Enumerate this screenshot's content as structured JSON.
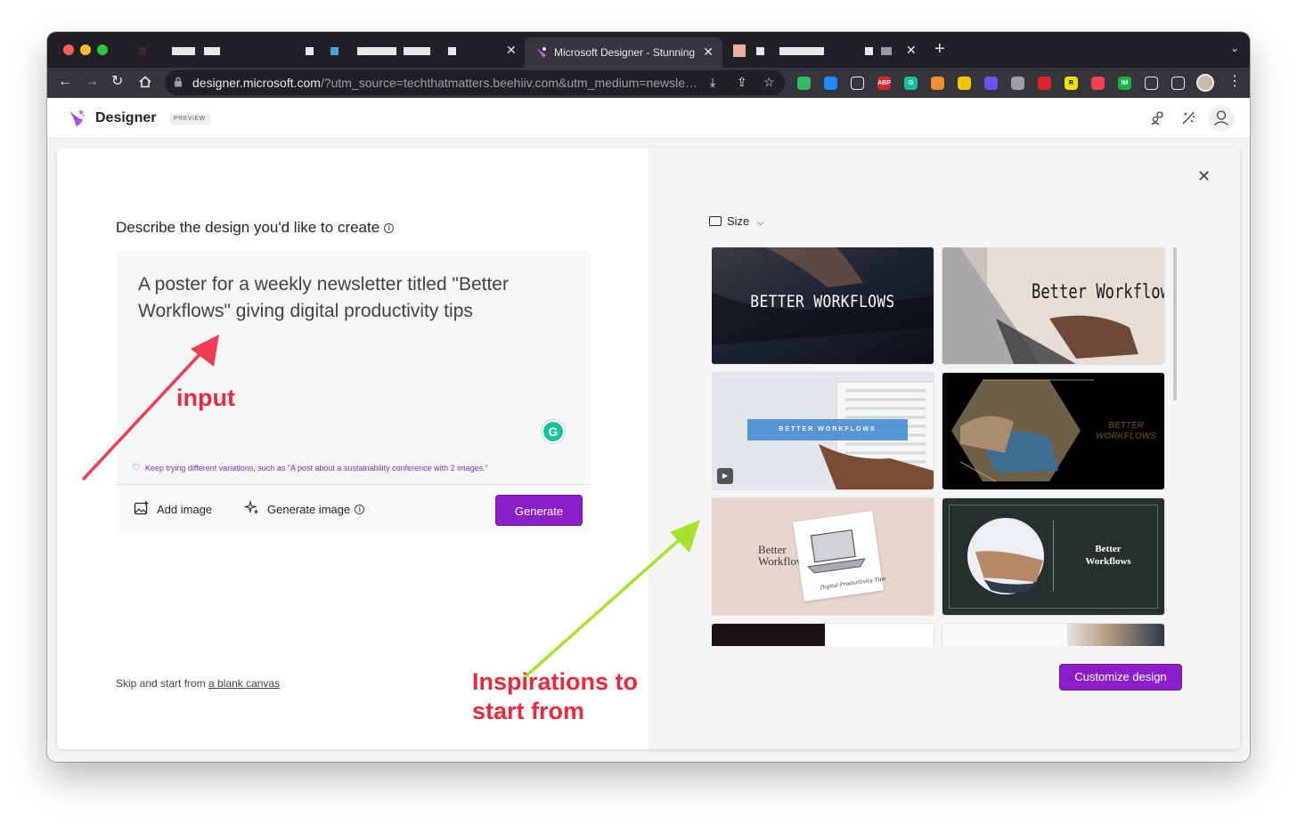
{
  "browser": {
    "active_tab": {
      "title": "Microsoft Designer - Stunning designs in a flash"
    },
    "url": {
      "host": "designer.microsoft.com",
      "rest": "/?utm_source=techthatmatters.beehiiv.com&utm_medium=newsletter"
    },
    "extensions": [
      {
        "icon": "evernote-icon",
        "color": "#2dbe60",
        "text": ""
      },
      {
        "icon": "1password-icon",
        "color": "#1a8cff",
        "text": ""
      },
      {
        "icon": "extension-5-icon",
        "color": "#35363a",
        "text": ""
      },
      {
        "icon": "adblock-plus-icon",
        "color": "#e0242b",
        "text": "ABP"
      },
      {
        "icon": "grammarly-icon",
        "color": "#15c39a",
        "text": "G"
      },
      {
        "icon": "dropper-icon",
        "color": "#f0902e",
        "text": ""
      },
      {
        "icon": "stripes-icon",
        "color": "#f5c400",
        "text": ""
      },
      {
        "icon": "asterisk-icon",
        "color": "#6b52ff",
        "text": ""
      },
      {
        "icon": "bird-icon",
        "color": "#9aa0a6",
        "text": ""
      },
      {
        "icon": "red-circle-icon",
        "color": "#e0242b",
        "text": ""
      },
      {
        "icon": "reader-icon",
        "color": "#f4e000",
        "text": "R"
      },
      {
        "icon": "pocket-icon",
        "color": "#ef4056",
        "text": ""
      },
      {
        "icon": "im-icon",
        "color": "#19b34a",
        "text": "IM"
      },
      {
        "icon": "puzzle-icon",
        "color": "#35363a",
        "text": ""
      },
      {
        "icon": "sidebar-icon",
        "color": "#35363a",
        "text": ""
      }
    ]
  },
  "app": {
    "brand": "Designer",
    "badge": "PREVIEW"
  },
  "left": {
    "heading": "Describe the design you'd like to create",
    "prompt": "A poster for a weekly newsletter titled \"Better Workflows\" giving digital productivity tips",
    "hint": "Keep trying different variations, such as \"A post about a sustainability conference with 2 images.\"",
    "add_image": "Add image",
    "generate_image": "Generate image",
    "generate": "Generate",
    "skip_prefix": "Skip and start from ",
    "skip_link": "a blank canvas"
  },
  "right": {
    "size_label": "Size",
    "customize": "Customize design",
    "cards": [
      {
        "text": "BETTER WORKFLOWS"
      },
      {
        "text": "Better Workflows"
      },
      {
        "text": "BETTER WORKFLOWS"
      },
      {
        "text": "BETTER WORKFLOWS"
      },
      {
        "line1": "Better",
        "line2": "Workflows",
        "subtitle": "Digital Productivity Tips"
      },
      {
        "line1": "Better",
        "line2": "Workflows"
      }
    ]
  },
  "annotations": {
    "input": "input",
    "inspirations_line1": "Inspirations to",
    "inspirations_line2": "start from"
  },
  "colors": {
    "accent": "#8a1ec9",
    "annotation_red": "#ea2a40",
    "annotation_green": "#a6e22e"
  }
}
